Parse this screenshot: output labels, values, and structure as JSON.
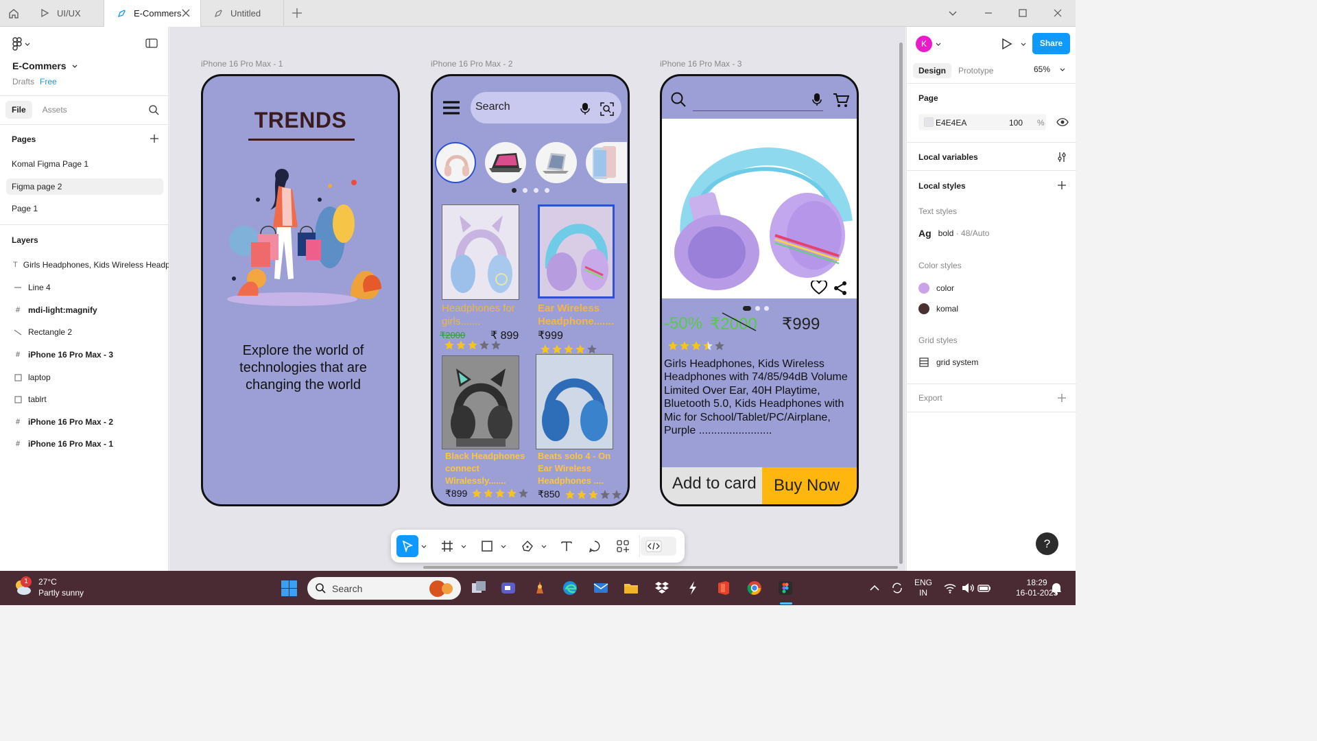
{
  "tabs": [
    {
      "label": "UI/UX"
    },
    {
      "label": "E-Commers"
    },
    {
      "label": "Untitled"
    }
  ],
  "left": {
    "project_name": "E-Commers",
    "drafts": "Drafts",
    "plan": "Free",
    "file_tab": "File",
    "assets_tab": "Assets",
    "pages_title": "Pages",
    "pages": [
      "Komal Figma Page 1",
      "Figma page 2",
      "Page 1"
    ],
    "selected_page": "Figma page 2",
    "layers_title": "Layers",
    "layers": [
      {
        "label": "Girls Headphones, Kids Wireless Headphones",
        "type": "text"
      },
      {
        "label": "Line 4",
        "type": "line"
      },
      {
        "label": "mdi-light:magnify",
        "type": "frame"
      },
      {
        "label": "Rectangle 2",
        "type": "line"
      },
      {
        "label": "iPhone 16 Pro Max - 3",
        "type": "frame"
      },
      {
        "label": "laptop",
        "type": "rect"
      },
      {
        "label": "tablrt",
        "type": "rect"
      },
      {
        "label": "iPhone 16 Pro Max - 2",
        "type": "frame"
      },
      {
        "label": "iPhone 16 Pro Max - 1",
        "type": "frame"
      }
    ]
  },
  "canvas": {
    "frames": [
      "iPhone 16 Pro Max - 1",
      "iPhone 16 Pro Max - 2",
      "iPhone 16 Pro Max - 3"
    ],
    "phone1": {
      "title": "TRENDS",
      "text": "Explore the world of technologies that are changing the world"
    },
    "phone2": {
      "search_placeholder": "Search",
      "products": [
        {
          "title": "Headphones for girls.......",
          "old_price": "₹2000",
          "price": "₹ 899",
          "rating": 3
        },
        {
          "title": "Ear Wireless Headphone.......",
          "price": "₹999",
          "rating": 4
        },
        {
          "title": "Black Headphones connect Wiralessly.......",
          "price": "₹899",
          "rating": 4
        },
        {
          "title": "Beats solo 4 - On Ear Wireless Headphones ....",
          "price": "₹850",
          "rating": 3
        }
      ]
    },
    "phone3": {
      "discount": "-50%",
      "old_price": "₹2000",
      "price": "₹999",
      "rating": 3.5,
      "description": "Girls Headphones, Kids Wireless Headphones with 74/85/94dB Volume Limited Over Ear, 40H Playtime, Bluetooth 5.0, Kids Headphones with Mic for School/Tablet/PC/Airplane, Purple ........................",
      "add_label": "Add to card",
      "buy_label": "Buy Now"
    }
  },
  "right": {
    "avatar_letter": "K",
    "share": "Share",
    "design_tab": "Design",
    "prototype_tab": "Prototype",
    "zoom": "65%",
    "page_title": "Page",
    "page_color": "E4E4EA",
    "page_opacity": "100",
    "pct": "%",
    "local_variables": "Local variables",
    "local_styles": "Local styles",
    "text_styles": "Text styles",
    "text_style_ag": "Ag",
    "text_style_name": "bold",
    "text_style_meta": " · 48/Auto",
    "color_styles": "Color styles",
    "colors": [
      {
        "name": "color",
        "hex": "#c9a2e8"
      },
      {
        "name": "komal",
        "hex": "#4a3030"
      }
    ],
    "grid_styles": "Grid styles",
    "grid_name": "grid system",
    "export": "Export",
    "help": "?"
  },
  "taskbar": {
    "temp": "27°C",
    "weather": "Partly sunny",
    "badge": "1",
    "search": "Search",
    "lang1": "ENG",
    "lang2": "IN",
    "time": "18:29",
    "date": "16-01-2025"
  }
}
